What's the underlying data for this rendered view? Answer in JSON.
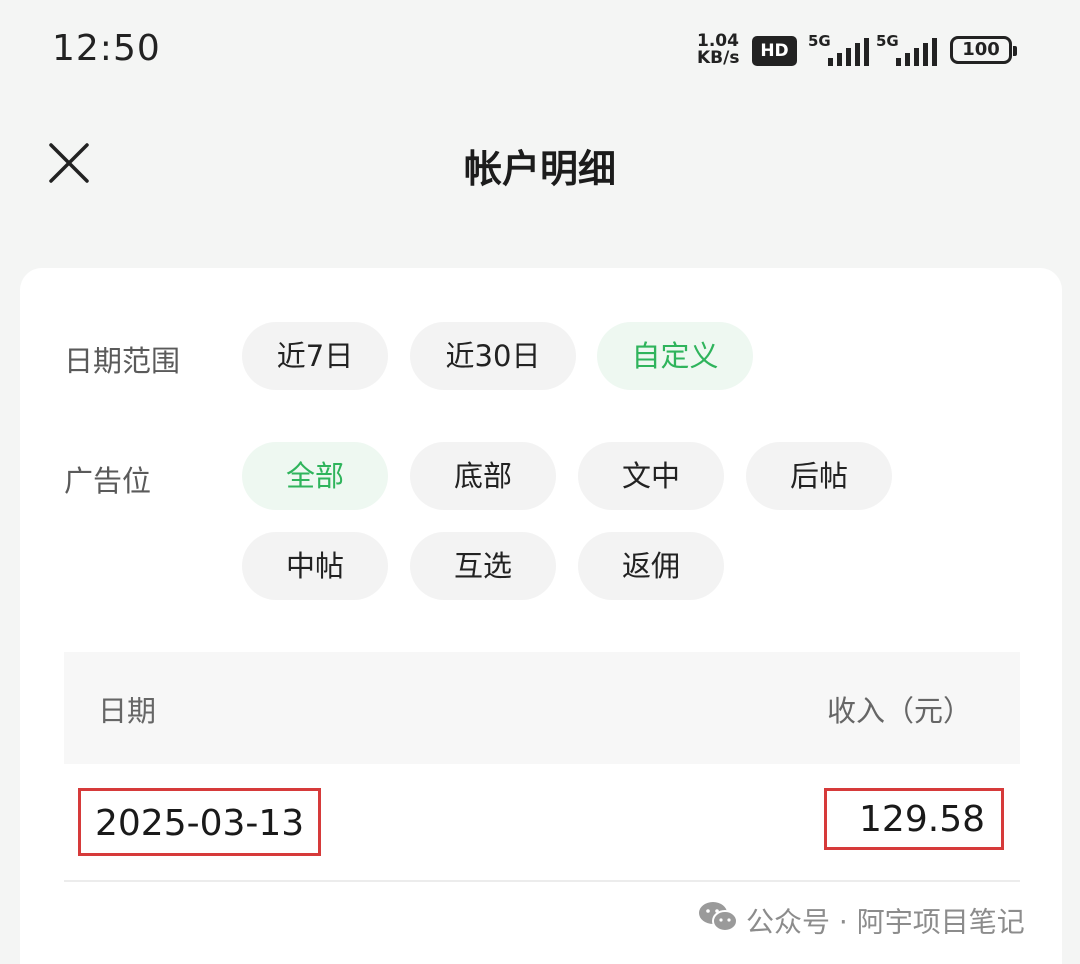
{
  "status_bar": {
    "time": "12:50",
    "net_speed_value": "1.04",
    "net_speed_unit": "KB/s",
    "hd_label": "HD",
    "signal_1_label": "5G",
    "signal_2_label": "5G",
    "battery_level": "100"
  },
  "header": {
    "title": "帐户明细",
    "close_icon": "close-icon"
  },
  "filters": {
    "date_range": {
      "label": "日期范围",
      "options": [
        "近7日",
        "近30日",
        "自定义"
      ],
      "selected": "自定义"
    },
    "ad_slot": {
      "label": "广告位",
      "options": [
        "全部",
        "底部",
        "文中",
        "后帖",
        "中帖",
        "互选",
        "返佣"
      ],
      "selected": "全部"
    }
  },
  "table": {
    "columns": [
      "日期",
      "收入（元）"
    ],
    "rows": [
      {
        "date": "2025-03-13",
        "income": "129.58"
      }
    ]
  },
  "watermark": {
    "text": "公众号 · 阿宇项目笔记",
    "icon": "wechat-icon"
  },
  "colors": {
    "accent_green": "#2fb45c",
    "highlight_red": "#d63a3a",
    "background": "#f4f5f4"
  }
}
